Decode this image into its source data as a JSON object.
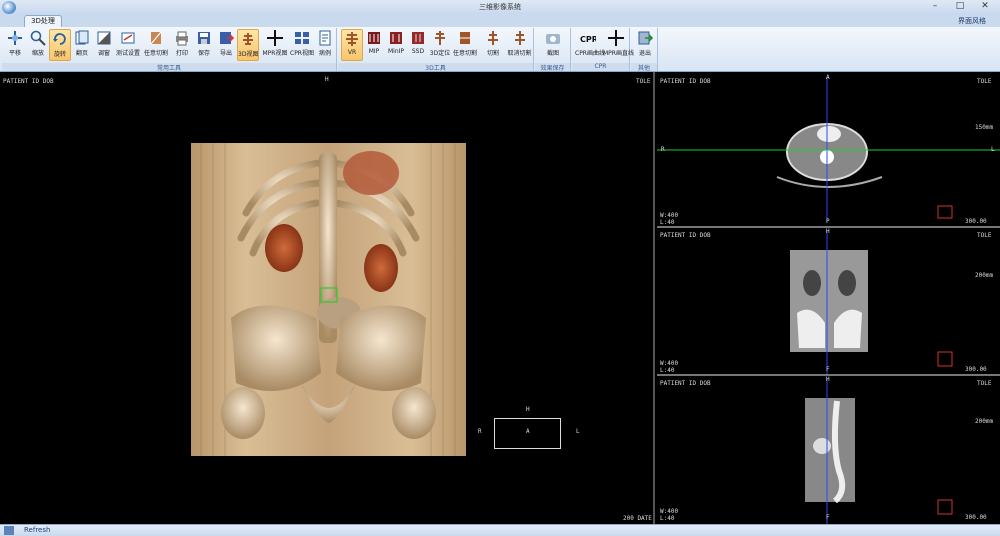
{
  "window": {
    "title": "三维影像系统"
  },
  "tabs": {
    "active": "3D处理"
  },
  "layout_menu": "界面风格",
  "ribbon": {
    "group_common": "常用工具",
    "group_3d": "3D工具",
    "group_effect": "效果保存",
    "group_cpr": "CPR",
    "group_exit": "其他",
    "common_buttons": [
      "平移",
      "缩放",
      "旋转",
      "翻页",
      "调窗",
      "测试设置",
      "任意切割",
      "打印",
      "保存",
      "导出",
      "3D视图",
      "MPR视图",
      "CPR视图",
      "病例"
    ],
    "tools_buttons": [
      "VR",
      "MIP",
      "MinIP",
      "SSD",
      "3D定位",
      "任意切割",
      "切割",
      "取消切割"
    ],
    "effect_buttons": [
      "截图"
    ],
    "cpr_buttons": [
      "CPR画曲线",
      "MPR画直线"
    ],
    "exit_buttons": [
      "退出"
    ]
  },
  "viewport_3d": {
    "patient": "PATIENT ID    DOB",
    "top_label": "H",
    "right_label": "TOLE",
    "bottom_right": "200 DATE",
    "orientation": {
      "H": "H",
      "R": "R",
      "A": "A",
      "L": "L"
    }
  },
  "viewport_axial": {
    "patient": "PATIENT ID    DOB",
    "right_label": "TOLE",
    "scale": "150mm",
    "top": "A",
    "left": "R",
    "right": "L",
    "bottom": "P",
    "wl": "W:400\nL:40",
    "corner": "300.00"
  },
  "viewport_coronal": {
    "patient": "PATIENT ID    DOB",
    "right_label": "TOLE",
    "scale": "200mm",
    "top": "H",
    "bottom": "F",
    "wl": "W:400\nL:40",
    "corner": "300.00"
  },
  "viewport_sagittal": {
    "patient": "PATIENT ID    DOB",
    "right_label": "TOLE",
    "scale": "200mm",
    "top": "H",
    "bottom": "F",
    "wl": "W:400\nL:40",
    "corner": "300.00"
  },
  "status": {
    "refresh": "Refresh"
  },
  "colors": {
    "ribbon": "#dfe9f5",
    "active_button": "#f8c56b",
    "crosshair_v": "#3344ff",
    "crosshair_h": "#22cc22"
  }
}
